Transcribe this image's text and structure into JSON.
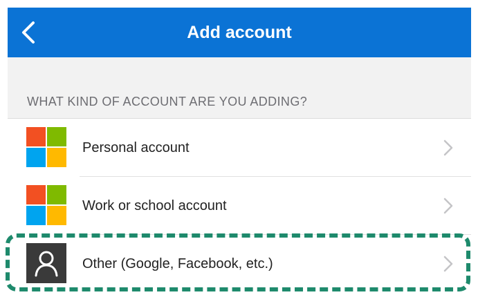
{
  "navbar": {
    "title": "Add account",
    "back_icon": "chevron-left-icon",
    "background_color": "#0b73d5"
  },
  "section_header": "WHAT KIND OF ACCOUNT ARE YOU ADDING?",
  "account_types": [
    {
      "label": "Personal account",
      "icon": "microsoft-logo-icon"
    },
    {
      "label": "Work or school account",
      "icon": "microsoft-logo-icon"
    },
    {
      "label": "Other (Google, Facebook, etc.)",
      "icon": "person-icon"
    }
  ],
  "highlight": {
    "target": "Other (Google, Facebook, etc.)",
    "style": "dashed",
    "color": "#1e8a6c"
  },
  "colors": {
    "microsoft_red": "#f25022",
    "microsoft_green": "#7fba00",
    "microsoft_blue": "#00a4ef",
    "microsoft_yellow": "#ffb900"
  }
}
